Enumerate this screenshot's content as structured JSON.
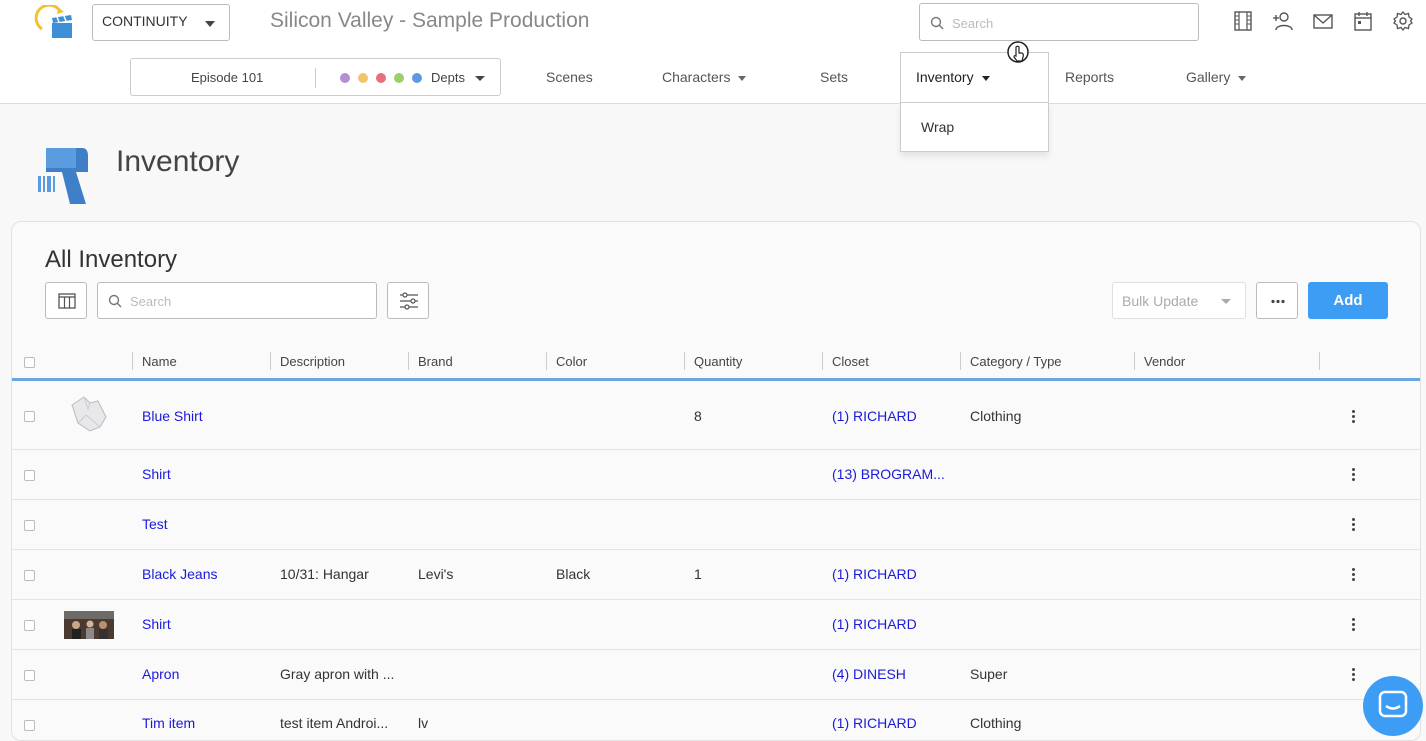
{
  "header": {
    "production_selector": "CONTINUITY",
    "app_title": "Silicon Valley - Sample Production",
    "search_placeholder": "Search"
  },
  "subnav": {
    "episode": "Episode 101",
    "depts_label": "Depts",
    "dept_colors": [
      "#b58fd6",
      "#f2c36b",
      "#e8707e",
      "#9fce68",
      "#5b9bde"
    ],
    "items": {
      "scenes": "Scenes",
      "characters": "Characters",
      "sets": "Sets",
      "inventory": "Inventory",
      "reports": "Reports",
      "gallery": "Gallery"
    },
    "inventory_menu": [
      "Wrap"
    ]
  },
  "page": {
    "title": "Inventory"
  },
  "inventory": {
    "title": "All Inventory",
    "search_placeholder": "Search",
    "bulk_update": "Bulk Update",
    "add_label": "Add",
    "columns": [
      "Name",
      "Description",
      "Brand",
      "Color",
      "Quantity",
      "Closet",
      "Category / Type",
      "Vendor"
    ],
    "rows": [
      {
        "name": "Blue Shirt",
        "description": "",
        "brand": "",
        "color": "",
        "quantity": "8",
        "closet": "(1) RICHARD",
        "category": "Clothing",
        "vendor": ""
      },
      {
        "name": "Shirt",
        "description": "",
        "brand": "",
        "color": "",
        "quantity": "",
        "closet": "(13) BROGRAM...",
        "category": "",
        "vendor": ""
      },
      {
        "name": "Test",
        "description": "",
        "brand": "",
        "color": "",
        "quantity": "",
        "closet": "",
        "category": "",
        "vendor": ""
      },
      {
        "name": "Black Jeans",
        "description": "10/31: Hangar",
        "brand": "Levi's",
        "color": "Black",
        "quantity": "1",
        "closet": "(1) RICHARD",
        "category": "",
        "vendor": ""
      },
      {
        "name": "Shirt",
        "description": "",
        "brand": "",
        "color": "",
        "quantity": "",
        "closet": "(1) RICHARD",
        "category": "",
        "vendor": ""
      },
      {
        "name": "Apron",
        "description": "Gray apron with ...",
        "brand": "",
        "color": "",
        "quantity": "",
        "closet": "(4) DINESH",
        "category": "Super",
        "vendor": ""
      },
      {
        "name": "Tim item",
        "description": "test item Androi...",
        "brand": "lv",
        "color": "",
        "quantity": "",
        "closet": "(1) RICHARD",
        "category": "Clothing",
        "vendor": ""
      }
    ]
  },
  "colors": {
    "accent": "#3d9df4",
    "link": "#1a1adb"
  }
}
